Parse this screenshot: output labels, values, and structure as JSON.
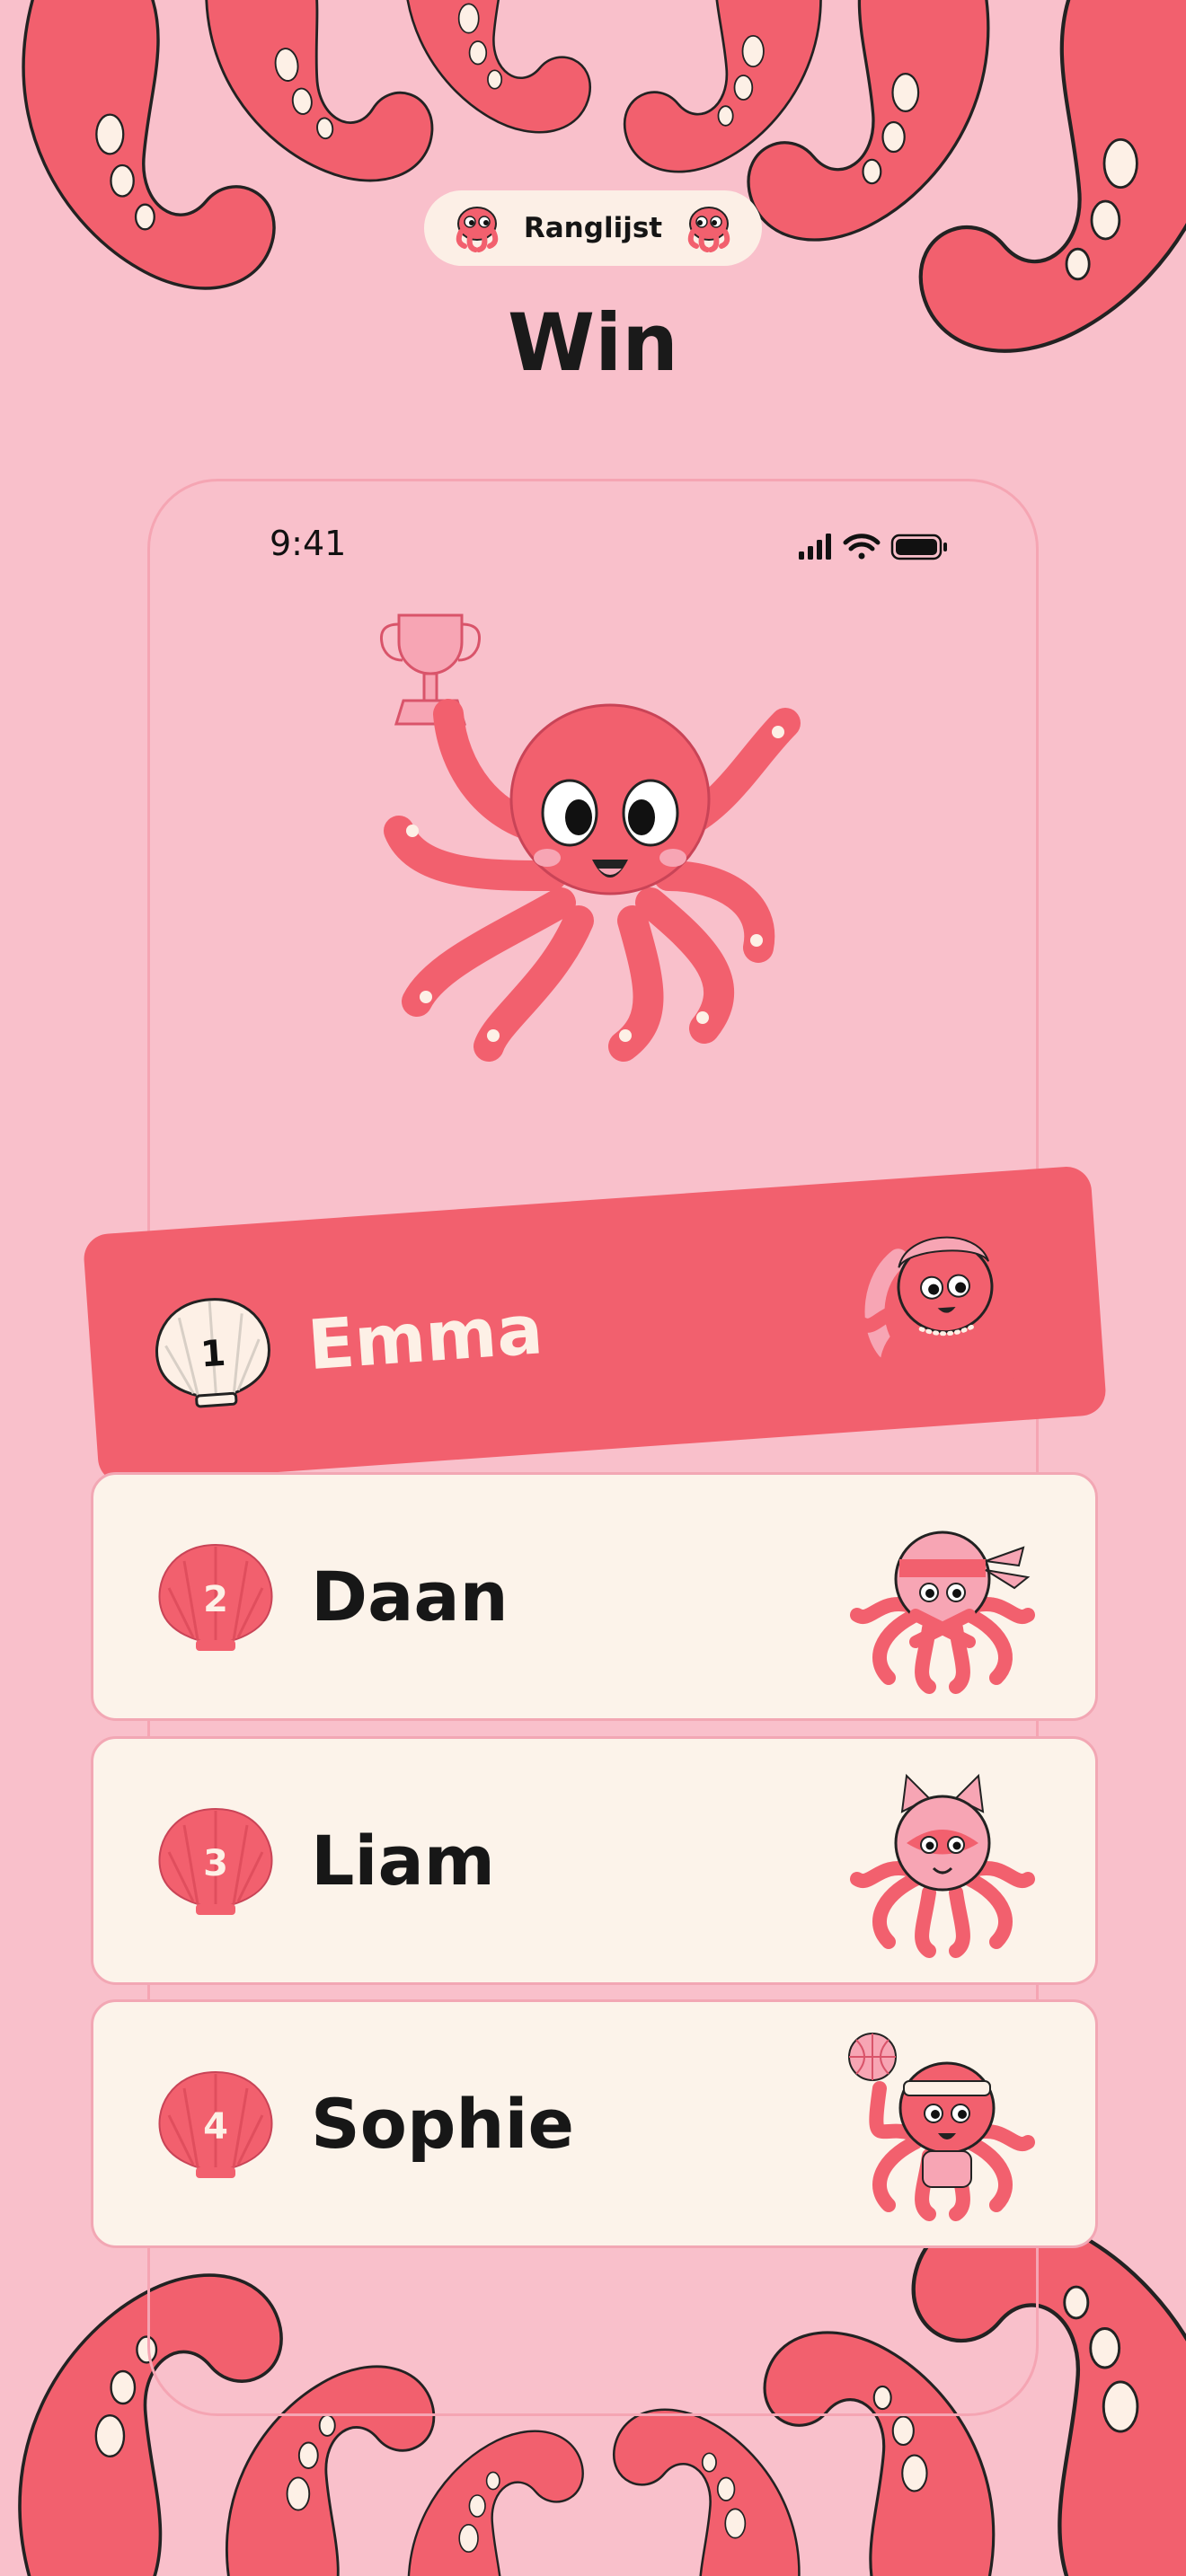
{
  "header": {
    "tab_label": "Ranglijst",
    "title": "Win"
  },
  "status_bar": {
    "time": "9:41",
    "icons": [
      "cellular-signal-icon",
      "wifi-icon",
      "battery-icon"
    ]
  },
  "hero": {
    "icon": "octopus-trophy-icon"
  },
  "leaderboard": [
    {
      "rank": "1",
      "name": "Emma",
      "avatar": "mermaid-octopus-icon",
      "highlighted": true
    },
    {
      "rank": "2",
      "name": "Daan",
      "avatar": "ninja-octopus-icon",
      "highlighted": false
    },
    {
      "rank": "3",
      "name": "Liam",
      "avatar": "cat-mask-octopus-icon",
      "highlighted": false
    },
    {
      "rank": "4",
      "name": "Sophie",
      "avatar": "basketball-octopus-icon",
      "highlighted": false
    }
  ],
  "colors": {
    "background": "#f9c0cb",
    "accent": "#f2606e",
    "card": "#fcf3ea",
    "text": "#171717"
  }
}
